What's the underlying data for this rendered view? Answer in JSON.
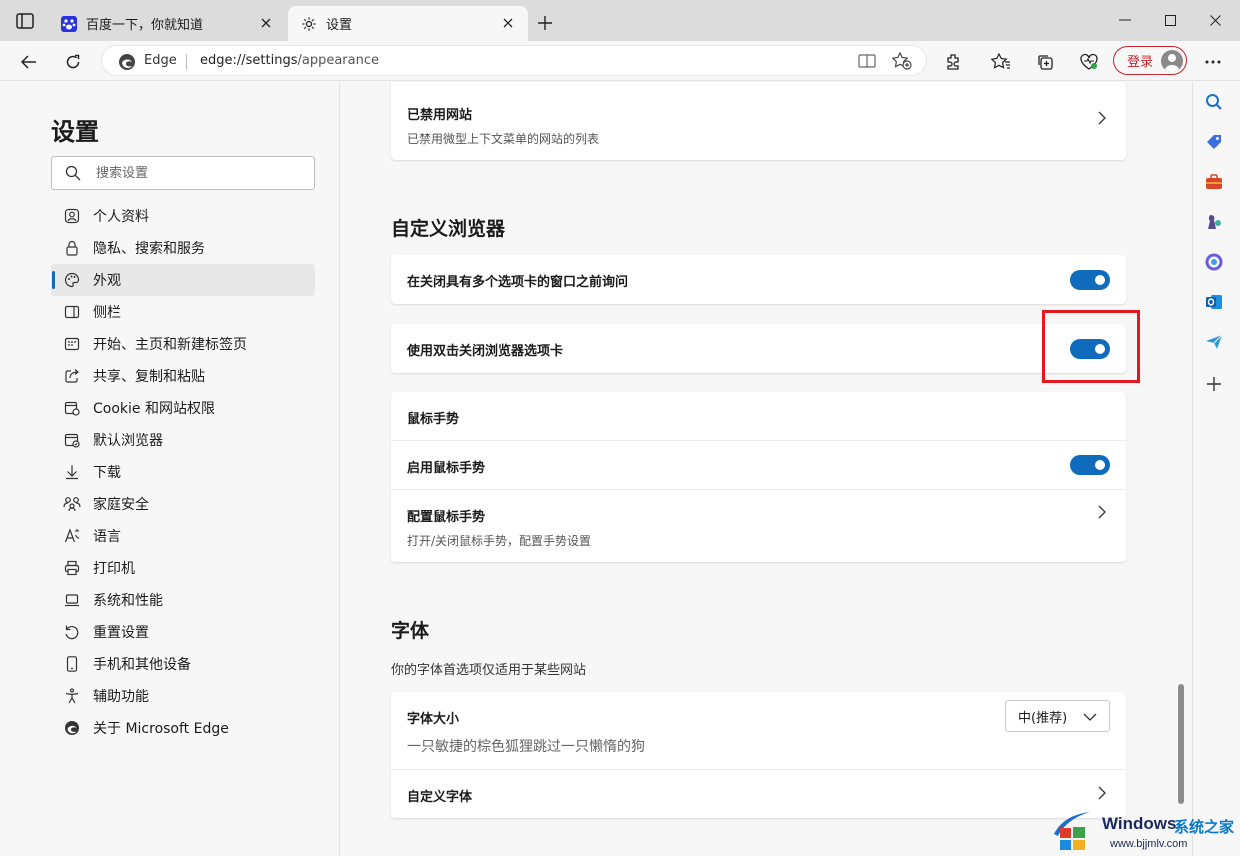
{
  "tabs": [
    {
      "label": "百度一下，你就知道",
      "icon": "baidu-icon"
    },
    {
      "label": "设置",
      "icon": "gear-icon"
    }
  ],
  "address": {
    "edge_label": "Edge",
    "url_host": "edge://settings",
    "url_path": "/appearance"
  },
  "login_label": "登录",
  "settings_title": "设置",
  "search_placeholder": "搜索设置",
  "nav": [
    {
      "label": "个人资料",
      "icon": "profile-icon"
    },
    {
      "label": "隐私、搜索和服务",
      "icon": "lock-icon"
    },
    {
      "label": "外观",
      "icon": "palette-icon",
      "selected": true
    },
    {
      "label": "侧栏",
      "icon": "sidebar-icon"
    },
    {
      "label": "开始、主页和新建标签页",
      "icon": "home-page-icon"
    },
    {
      "label": "共享、复制和粘贴",
      "icon": "share-icon"
    },
    {
      "label": "Cookie 和网站权限",
      "icon": "cookie-icon"
    },
    {
      "label": "默认浏览器",
      "icon": "default-browser-icon"
    },
    {
      "label": "下载",
      "icon": "download-icon"
    },
    {
      "label": "家庭安全",
      "icon": "family-icon"
    },
    {
      "label": "语言",
      "icon": "language-icon"
    },
    {
      "label": "打印机",
      "icon": "printer-icon"
    },
    {
      "label": "系统和性能",
      "icon": "laptop-icon"
    },
    {
      "label": "重置设置",
      "icon": "reset-icon"
    },
    {
      "label": "手机和其他设备",
      "icon": "phone-icon"
    },
    {
      "label": "辅助功能",
      "icon": "accessibility-icon"
    },
    {
      "label": "关于 Microsoft Edge",
      "icon": "edge-logo-icon"
    }
  ],
  "content": {
    "blocked_sites": {
      "title": "已禁用网站",
      "subtitle": "已禁用微型上下文菜单的网站的列表"
    },
    "customize_heading": "自定义浏览器",
    "ask_before_close": {
      "title": "在关闭具有多个选项卡的窗口之前询问",
      "on": true
    },
    "double_click_close": {
      "title": "使用双击关闭浏览器选项卡",
      "on": true
    },
    "mouse_gesture": {
      "header": "鼠标手势",
      "enable": {
        "title": "启用鼠标手势",
        "on": true
      },
      "configure": {
        "title": "配置鼠标手势",
        "subtitle": "打开/关闭鼠标手势，配置手势设置"
      }
    },
    "font_heading": "字体",
    "font_desc": "你的字体首选项仅适用于某些网站",
    "font_size": {
      "title": "字体大小",
      "preview": "一只敏捷的棕色狐狸跳过一只懒惰的狗",
      "selected": "中(推荐)"
    },
    "custom_fonts": {
      "title": "自定义字体"
    }
  },
  "watermark": {
    "brand": "Windows",
    "cn": "系统之家",
    "url": "www.bjjmlv.com"
  },
  "colors": {
    "accent": "#0f6cbd",
    "highlight": "#e0191f",
    "login": "#c4262e"
  }
}
